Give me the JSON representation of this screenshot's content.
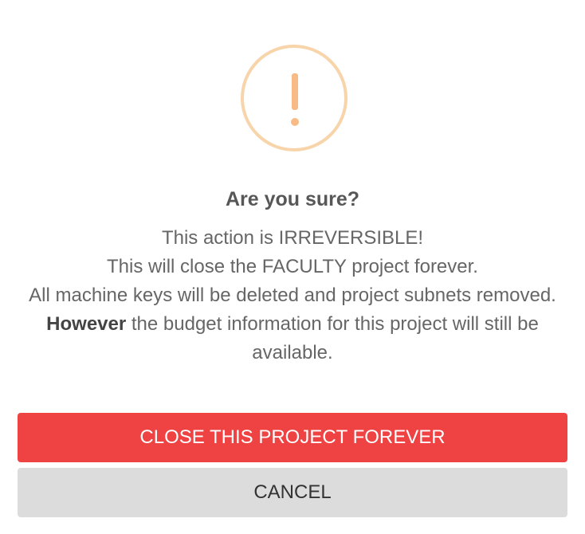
{
  "dialog": {
    "icon": "warning-exclamation-icon",
    "title": "Are you sure?",
    "message": {
      "line1": "This action is IRREVERSIBLE!",
      "line2": "This will close the FACULTY project forever.",
      "line3": "All machine keys will be deleted and project subnets removed.",
      "line4_bold": "However",
      "line4_rest": " the budget information for this project will still be available."
    },
    "confirm_label": "CLOSE THIS PROJECT FOREVER",
    "cancel_label": "CANCEL"
  },
  "colors": {
    "warning": "#f8bb86",
    "confirm": "#ef4242",
    "cancel": "#dbdcdb"
  }
}
